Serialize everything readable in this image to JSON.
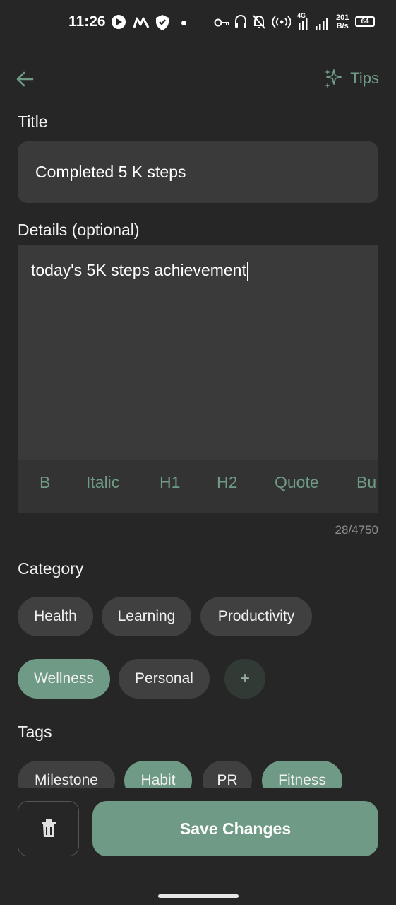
{
  "status_bar": {
    "time": "11:26",
    "net_speed_value": "201",
    "net_speed_unit": "B/s",
    "network_type": "4G",
    "battery": "64"
  },
  "header": {
    "tips_label": "Tips"
  },
  "title_section": {
    "label": "Title",
    "value": "Completed 5 K steps"
  },
  "details_section": {
    "label": "Details (optional)",
    "value": "today's 5K steps achievement",
    "toolbar": [
      "B",
      "Italic",
      "H1",
      "H2",
      "Quote",
      "Bu"
    ],
    "counter": "28/4750"
  },
  "category_section": {
    "label": "Category",
    "chips": [
      "Health",
      "Learning",
      "Productivity",
      "Wellness",
      "Personal"
    ],
    "selected": "Wellness",
    "add_label": "+"
  },
  "tags_section": {
    "label": "Tags",
    "chips": [
      "Milestone",
      "Habit",
      "PR",
      "Fitness"
    ],
    "selected": [
      "Habit",
      "Fitness"
    ]
  },
  "actions": {
    "save_label": "Save Changes"
  },
  "colors": {
    "background": "#262626",
    "surface": "#3a3a3a",
    "accent": "#6f9a85"
  }
}
